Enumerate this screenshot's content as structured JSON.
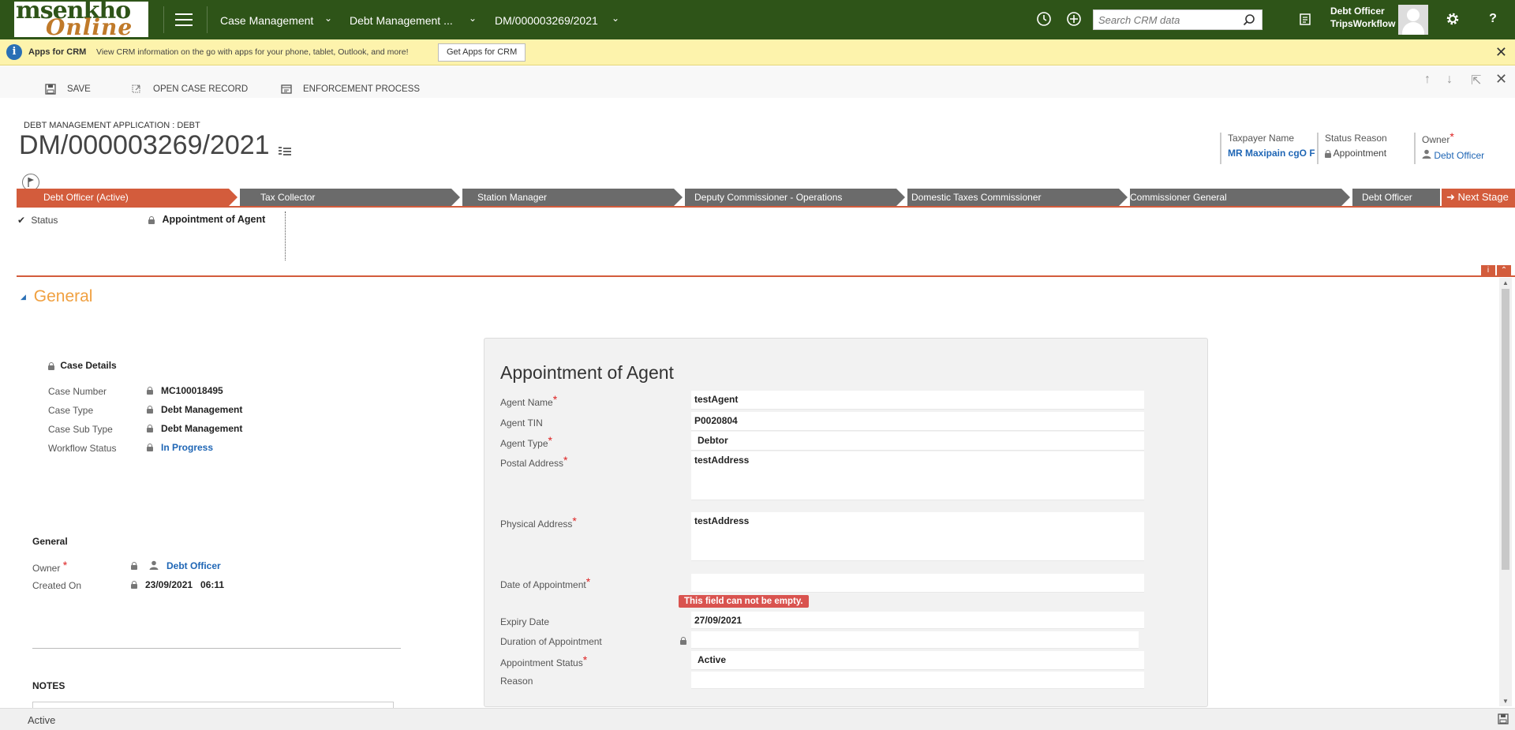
{
  "topnav": {
    "logo_line1": "msenkho",
    "logo_line2": "Online",
    "breadcrumb": [
      "Case Management",
      "Debt Management ...",
      "DM/000003269/2021"
    ],
    "search_placeholder": "Search CRM data",
    "user_role": "Debt Officer",
    "user_org": "TripsWorkflow",
    "help_label": "?"
  },
  "notification": {
    "title": "Apps for CRM",
    "text": "View CRM information on the go with apps for your phone, tablet, Outlook, and more!",
    "button": "Get Apps for CRM"
  },
  "commands": {
    "save": "SAVE",
    "open_case": "OPEN CASE RECORD",
    "enforcement": "ENFORCEMENT PROCESS"
  },
  "header": {
    "entity": "DEBT MANAGEMENT APPLICATION : DEBT",
    "title": "DM/000003269/2021",
    "fields": [
      {
        "label": "Taxpayer Name",
        "value": "MR Maxipain cgO F"
      },
      {
        "label": "Status Reason",
        "value": "Appointment"
      },
      {
        "label": "Owner",
        "value": "Debt Officer"
      }
    ]
  },
  "process": {
    "stages": [
      "Debt Officer (Active)",
      "Tax Collector",
      "Station Manager",
      "Deputy Commissioner - Operations",
      "Domestic Taxes Commissioner",
      "Commissioner General",
      "Debt Officer"
    ],
    "next_stage": "Next Stage",
    "status_label": "Status",
    "status_value": "Appointment of Agent"
  },
  "general": {
    "section_title": "General",
    "case_details_title": "Case Details",
    "case_fields": [
      {
        "label": "Case Number",
        "value": "MC100018495"
      },
      {
        "label": "Case Type",
        "value": "Debt Management"
      },
      {
        "label": "Case Sub Type",
        "value": "Debt Management"
      },
      {
        "label": "Workflow Status",
        "value": "In Progress"
      }
    ],
    "general_title": "General",
    "owner_label": "Owner",
    "owner_value": "Debt Officer",
    "created_label": "Created On",
    "created_value": "23/09/2021   06:11",
    "notes_title": "NOTES"
  },
  "appointment": {
    "title": "Appointment of Agent",
    "fields": [
      {
        "label": "Agent Name",
        "value": "testAgent"
      },
      {
        "label": "Agent TIN",
        "value": "P0020804"
      },
      {
        "label": "Agent Type",
        "value": "Debtor"
      },
      {
        "label": "Postal Address",
        "value": "testAddress"
      },
      {
        "label": "Physical Address",
        "value": "testAddress"
      },
      {
        "label": "Date of Appointment",
        "value": ""
      },
      {
        "label": "Expiry Date",
        "value": "27/09/2021"
      },
      {
        "label": "Duration of Appointment",
        "value": ""
      },
      {
        "label": "Appointment Status",
        "value": "Active"
      },
      {
        "label": "Reason",
        "value": ""
      }
    ],
    "error": "This field can not be empty."
  },
  "footer": {
    "status": "Active"
  },
  "colors": {
    "nav_green": "#2e5418",
    "process_active": "#d35c3c",
    "process_inactive": "#6b6b6b",
    "link_blue": "#1f66b5",
    "section_orange": "#f0a040",
    "notif_yellow": "#fdf3ac"
  }
}
